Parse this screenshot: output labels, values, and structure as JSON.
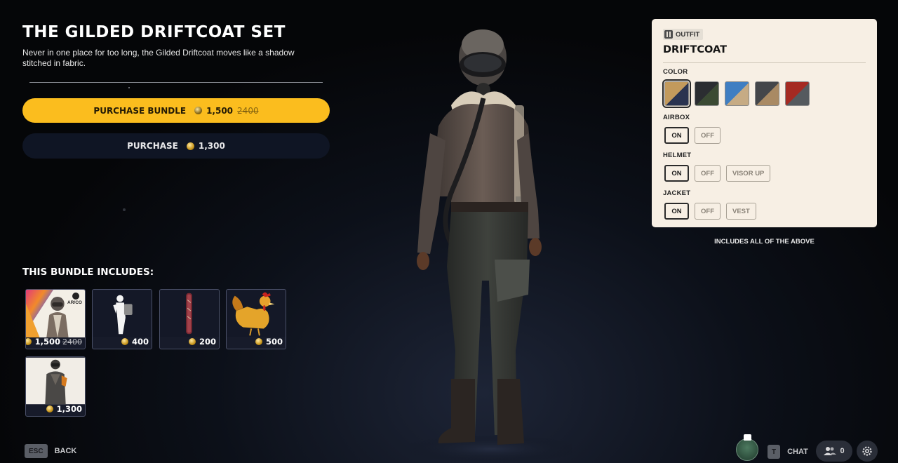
{
  "header": {
    "title": "THE GILDED DRIFTCOAT SET",
    "description": "Never in one place for too long, the Gilded Driftcoat moves like a shadow stitched in fabric."
  },
  "actions": {
    "purchase_bundle_label": "PURCHASE BUNDLE",
    "purchase_bundle_price": "1,500",
    "purchase_bundle_original_price": "2400",
    "purchase_label": "PURCHASE",
    "purchase_price": "1,300"
  },
  "bundle": {
    "title": "THIS BUNDLE INCLUDES:",
    "items": [
      {
        "price": "1,500",
        "original_price": "2400",
        "icon": "bundle-character-card",
        "badge": "AR/CO"
      },
      {
        "price": "400",
        "icon": "backpack-emote-silhouette"
      },
      {
        "price": "200",
        "icon": "strap-charm"
      },
      {
        "price": "500",
        "icon": "rooster"
      },
      {
        "price": "1,300",
        "icon": "outfit-character-portrait"
      }
    ]
  },
  "outfit_panel": {
    "badge": "OUTFIT",
    "name": "DRIFTCOAT",
    "color_label": "COLOR",
    "colors": [
      {
        "name": "tan-navy",
        "a": "#c39a5c",
        "b": "#2a3350"
      },
      {
        "name": "charcoal-green",
        "a": "#2b2d31",
        "b": "#3b4a33"
      },
      {
        "name": "blue-sand",
        "a": "#3f7ec2",
        "b": "#c6ab84"
      },
      {
        "name": "grey-tan",
        "a": "#44464a",
        "b": "#a98a64"
      },
      {
        "name": "red-grey",
        "a": "#a52a22",
        "b": "#555a5e"
      }
    ],
    "airbox": {
      "label": "AIRBOX",
      "options": [
        "ON",
        "OFF"
      ],
      "selected": "ON"
    },
    "helmet": {
      "label": "HELMET",
      "options": [
        "ON",
        "OFF",
        "VISOR UP"
      ],
      "selected": "ON"
    },
    "jacket": {
      "label": "JACKET",
      "options": [
        "ON",
        "OFF",
        "VEST"
      ],
      "selected": "ON"
    },
    "note": "INCLUDES ALL OF THE ABOVE"
  },
  "footer": {
    "back_key": "ESC",
    "back_label": "BACK",
    "chat_key": "T",
    "chat_label": "CHAT",
    "friends_count": "0"
  },
  "colors": {
    "accent": "#fbbd1e",
    "panel_bg": "#f7efe4"
  }
}
